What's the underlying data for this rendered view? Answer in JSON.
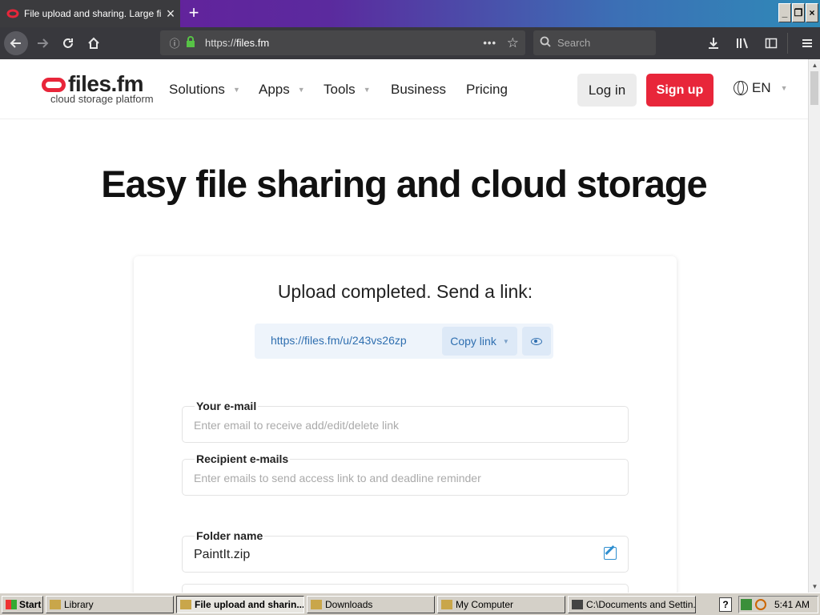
{
  "browser": {
    "tab_title": "File upload and sharing. Large file",
    "new_tab": "+",
    "url_prefix": "https://",
    "url_host": "files.fm",
    "search_placeholder": "Search"
  },
  "site": {
    "logo_name": "files.fm",
    "logo_tagline": "cloud storage platform",
    "nav": [
      "Solutions",
      "Apps",
      "Tools",
      "Business",
      "Pricing"
    ],
    "login": "Log in",
    "signup": "Sign up",
    "lang": "EN",
    "hero": "Easy file sharing and cloud storage"
  },
  "upload": {
    "title": "Upload completed. Send a link:",
    "link": "https://files.fm/u/243vs26zp",
    "copy_label": "Copy link"
  },
  "form": {
    "email_label": "Your e-mail",
    "email_placeholder": "Enter email to receive add/edit/delete link",
    "recipients_label": "Recipient e-mails",
    "recipients_placeholder": "Enter emails to send access link to and deadline reminder",
    "folder_label": "Folder name",
    "folder_value": "PaintIt.zip"
  },
  "taskbar": {
    "start": "Start",
    "items": [
      "Library",
      "File upload and sharin...",
      "Downloads",
      "My Computer",
      "C:\\Documents and Settin..."
    ],
    "help": "?",
    "clock": "5:41 AM"
  },
  "colors": {
    "brand_red": "#e8263a",
    "link_blue": "#2f6fb0"
  }
}
